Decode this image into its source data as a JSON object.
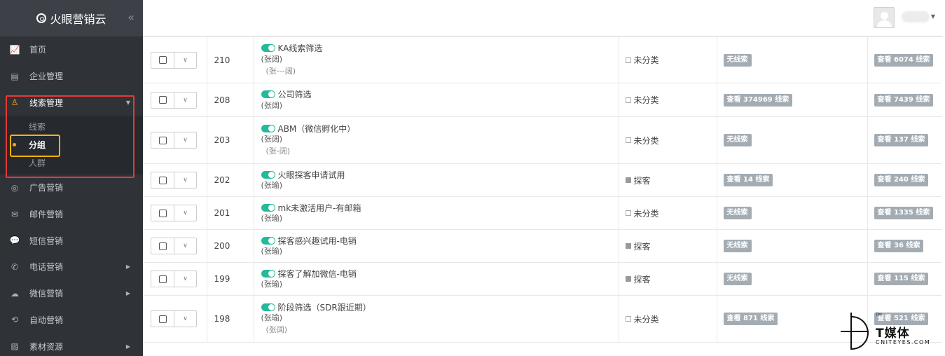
{
  "app": {
    "title": "火眼营销云",
    "collapse_glyph": "«"
  },
  "sidebar": {
    "items": [
      {
        "label": "首页",
        "icon": "chart-icon"
      },
      {
        "label": "企业管理",
        "icon": "building-icon"
      },
      {
        "label": "线索管理",
        "icon": "user-icon",
        "open": true
      },
      {
        "label": "广告营销",
        "icon": "target-icon"
      },
      {
        "label": "邮件营销",
        "icon": "mail-icon"
      },
      {
        "label": "短信营销",
        "icon": "chat-icon"
      },
      {
        "label": "电话营销",
        "icon": "phone-icon"
      },
      {
        "label": "微信营销",
        "icon": "wechat-icon"
      },
      {
        "label": "自动营销",
        "icon": "auto-icon"
      },
      {
        "label": "素材资源",
        "icon": "image-icon"
      }
    ],
    "sub_items": [
      {
        "label": "线索"
      },
      {
        "label": "分组",
        "active": true
      },
      {
        "label": "人群"
      }
    ]
  },
  "rows": [
    {
      "id": "210",
      "name": "KA线索筛选",
      "owner": "(张阔)",
      "creator": "(张---阔)",
      "category": "未分类",
      "category_filled": false,
      "leads1": "无线索",
      "leads2": "查看 6074 线索"
    },
    {
      "id": "208",
      "name": "公司筛选",
      "owner": "(张阔)",
      "creator": "",
      "category": "未分类",
      "category_filled": false,
      "leads1": "查看 374969 线索",
      "leads2": "查看 7439 线索"
    },
    {
      "id": "203",
      "name": "ABM（微信孵化中）",
      "owner": "(张阔)",
      "creator": "(张-阔)",
      "category": "未分类",
      "category_filled": false,
      "leads1": "无线索",
      "leads2": "查看 137 线索"
    },
    {
      "id": "202",
      "name": "火眼探客申请试用",
      "owner": "(张瑜)",
      "creator": "",
      "category": "探客",
      "category_filled": true,
      "leads1": "查看 14 线索",
      "leads2": "查看 240 线索"
    },
    {
      "id": "201",
      "name": "mk未激活用户-有邮箱",
      "owner": "(张瑜)",
      "creator": "",
      "category": "未分类",
      "category_filled": false,
      "leads1": "无线索",
      "leads2": "查看 1335 线索"
    },
    {
      "id": "200",
      "name": "探客感兴趣试用-电销",
      "owner": "(张瑜)",
      "creator": "",
      "category": "探客",
      "category_filled": true,
      "leads1": "无线索",
      "leads2": "查看 36 线索"
    },
    {
      "id": "199",
      "name": "探客了解加微信-电销",
      "owner": "(张瑜)",
      "creator": "",
      "category": "探客",
      "category_filled": true,
      "leads1": "无线索",
      "leads2": "查看 115 线索"
    },
    {
      "id": "198",
      "name": "阶段筛选（SDR跟近期）",
      "owner": "(张瑜)",
      "creator": "(张阔)",
      "category": "未分类",
      "category_filled": false,
      "leads1": "查看 871 线索",
      "leads2": "查看 521 线索"
    }
  ],
  "watermark": {
    "tm": "TM",
    "name": "T媒体",
    "site": "CNITEYES.COM"
  }
}
